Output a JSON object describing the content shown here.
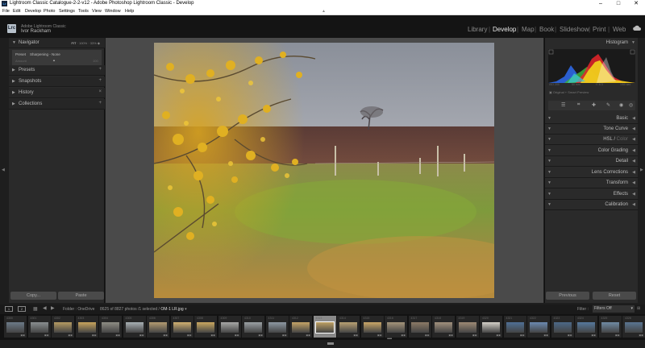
{
  "window": {
    "title": "Lightroom Classic Catalogue-2-2-v12 - Adobe Photoshop Lightroom Classic - Develop",
    "app_icon_text": "Lr",
    "controls": {
      "minimize": "–",
      "maximize": "□",
      "close": "✕"
    }
  },
  "menu": [
    "File",
    "Edit",
    "Develop",
    "Photo",
    "Settings",
    "Tools",
    "View",
    "Window",
    "Help"
  ],
  "menu_pin": "▲",
  "identity": {
    "logo_text": "Lrc",
    "product": "Adobe Lightroom Classic",
    "user": "Ivor Rackham"
  },
  "modules": {
    "items": [
      "Library",
      "Develop",
      "Map",
      "Book",
      "Slideshow",
      "Print",
      "Web"
    ],
    "active": "Develop",
    "separator": "|"
  },
  "cloud_icon": "cloud-icon",
  "left_panel": {
    "navigator": {
      "label": "Navigator",
      "fit": "FIT",
      "opt2": "100%",
      "opt3": "33%",
      "preset_label": "Preset",
      "preset_value": "Sharpening - None",
      "amount_label": "Amount",
      "amount_value": "100"
    },
    "sections": [
      {
        "label": "Presets",
        "action": "+"
      },
      {
        "label": "Snapshots",
        "action": "+"
      },
      {
        "label": "History",
        "action": "×"
      },
      {
        "label": "Collections",
        "action": "+"
      }
    ],
    "copy_label": "Copy...",
    "paste_label": "Paste"
  },
  "right_panel": {
    "histogram_label": "Histogram",
    "hist_info": [
      "ISO 200",
      "50 mm",
      "f / 6.3",
      "1/50 sec"
    ],
    "smart_preview": "Original + Smart Preview",
    "panels": [
      {
        "label": "Basic",
        "dim": ""
      },
      {
        "label": "Tone Curve",
        "dim": ""
      },
      {
        "label": "HSL / ",
        "dim": "Color"
      },
      {
        "label": "Color Grading",
        "dim": ""
      },
      {
        "label": "Detail",
        "dim": ""
      },
      {
        "label": "Lens Corrections",
        "dim": ""
      },
      {
        "label": "Transform",
        "dim": ""
      },
      {
        "label": "Effects",
        "dim": ""
      },
      {
        "label": "Calibration",
        "dim": ""
      }
    ],
    "previous_label": "Previous",
    "reset_label": "Reset",
    "colors": {
      "red": "#e8262a",
      "yellow": "#f2d61c",
      "green": "#3fb23a",
      "blue": "#2f6cf0",
      "cyan": "#3ac8dc"
    }
  },
  "filmstrip_bar": {
    "screen1": "1",
    "screen2": "2",
    "folder": "Folder : OneDrive",
    "count": "8625 of 8827 photos /1 selected /",
    "filename": "OM-1 LR.jpg",
    "filter_label": "Filter :",
    "filter_value": "Filters Off"
  },
  "filmstrip": {
    "thumbs": [
      {
        "n": "4300",
        "tone": "#6b7a88"
      },
      {
        "n": "4301",
        "tone": "#8a8f90"
      },
      {
        "n": "4302",
        "tone": "#b59a62"
      },
      {
        "n": "4303",
        "tone": "#c7a35c"
      },
      {
        "n": "4304",
        "tone": "#8f8d85"
      },
      {
        "n": "4305",
        "tone": "#a8b0b4"
      },
      {
        "n": "4306",
        "tone": "#b39a70"
      },
      {
        "n": "4307",
        "tone": "#d0b070"
      },
      {
        "n": "4308",
        "tone": "#caa860"
      },
      {
        "n": "4309",
        "tone": "#a7a8a6"
      },
      {
        "n": "4310",
        "tone": "#9aa0a4"
      },
      {
        "n": "4311",
        "tone": "#8d98a2"
      },
      {
        "n": "4312",
        "tone": "#c4a366"
      },
      {
        "n": "4313",
        "tone": "#bea064"
      },
      {
        "n": "4314",
        "tone": "#b8a072"
      },
      {
        "n": "4315",
        "tone": "#c9a667"
      },
      {
        "n": "4316",
        "tone": "#a4947a"
      },
      {
        "n": "4317",
        "tone": "#8c7a66"
      },
      {
        "n": "4318",
        "tone": "#a1917d"
      },
      {
        "n": "4319",
        "tone": "#9c8a74"
      },
      {
        "n": "4320",
        "tone": "#d4d0c8"
      },
      {
        "n": "4321",
        "tone": "#4f6f95"
      },
      {
        "n": "4322",
        "tone": "#6a89b0"
      },
      {
        "n": "4323",
        "tone": "#4c6888"
      },
      {
        "n": "4324",
        "tone": "#56789c"
      },
      {
        "n": "4325",
        "tone": "#6f8ba4"
      },
      {
        "n": "4326",
        "tone": "#5a7592"
      }
    ],
    "selected_index": 13,
    "dots": "• • • • •"
  }
}
